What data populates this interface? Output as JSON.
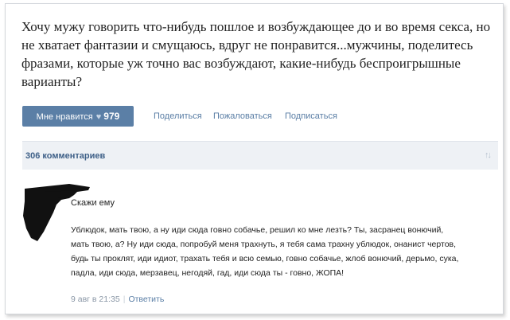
{
  "post": {
    "text": "Хочу мужу говорить что-нибудь пошлое и возбуждающее до и во время секса, но не хватает фантазии и смущаюсь, вдруг не понравится...мужчины, поделитесь фразами, которые уж точно вас возбуждают, какие-нибудь беспроигрышные варианты?"
  },
  "actions": {
    "like_label": "Мне нравится",
    "like_icon": "heart-icon",
    "like_count": "979",
    "share_label": "Поделиться",
    "report_label": "Пожаловаться",
    "subscribe_label": "Подписаться"
  },
  "comments": {
    "count_label": "306 комментариев",
    "sort_icon": "sort-arrows-icon"
  },
  "comment": {
    "author_line": "Скажи ему",
    "text": "Ублюдок, мать твою, а ну иди сюда говно собачье, решил ко мне лезть? Ты, засранец вонючий, мать твою, а? Ну иди сюда, попробуй меня трахнуть, я тебя сама трахну ублюдок, онанист чертов, будь ты проклят, иди идиот, трахать тебя и всю семью, говно собачье, жлоб вонючий, дерьмо, сука, падла, иди сюда, мерзавец, негодяй, гад, иди сюда ты - говно, ЖОПА!",
    "date": "9 авг в 21:35",
    "separator": "|",
    "reply_label": "Ответить"
  },
  "colors": {
    "like_button_bg": "#5b7fa6",
    "link": "#5a7ea5",
    "comments_bar_bg": "#eef1f5",
    "comments_count": "#3d5f87"
  }
}
